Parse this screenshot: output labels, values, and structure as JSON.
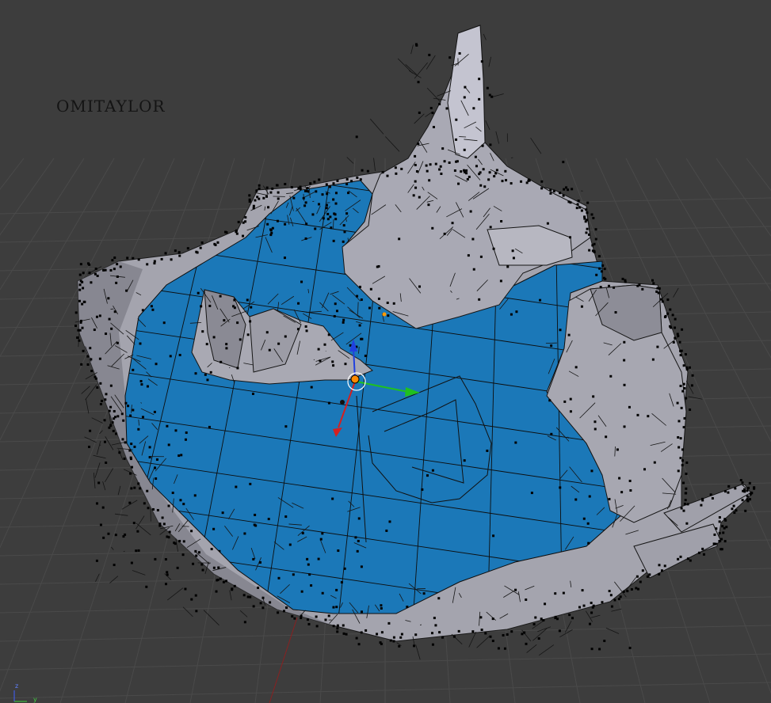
{
  "viewport": {
    "overlay_text": "OMITAYLOR",
    "mode": "edit-mode",
    "colors": {
      "background": "#3d3d3d",
      "grid": "#4a4a4a",
      "water": "#1d78b6",
      "rock": "#a6a6b0",
      "rock_dark": "#6e6e76",
      "wire": "#111111",
      "x_axis": "#d02020",
      "y_axis": "#20c020",
      "z_axis": "#2040e0",
      "pivot": "#ff8a00"
    }
  },
  "axis_widget": {
    "z_label": "z",
    "y_label": "y"
  },
  "manipulator": {
    "axes": [
      "x-axis-arrow",
      "y-axis-arrow",
      "z-axis-arrow"
    ]
  }
}
